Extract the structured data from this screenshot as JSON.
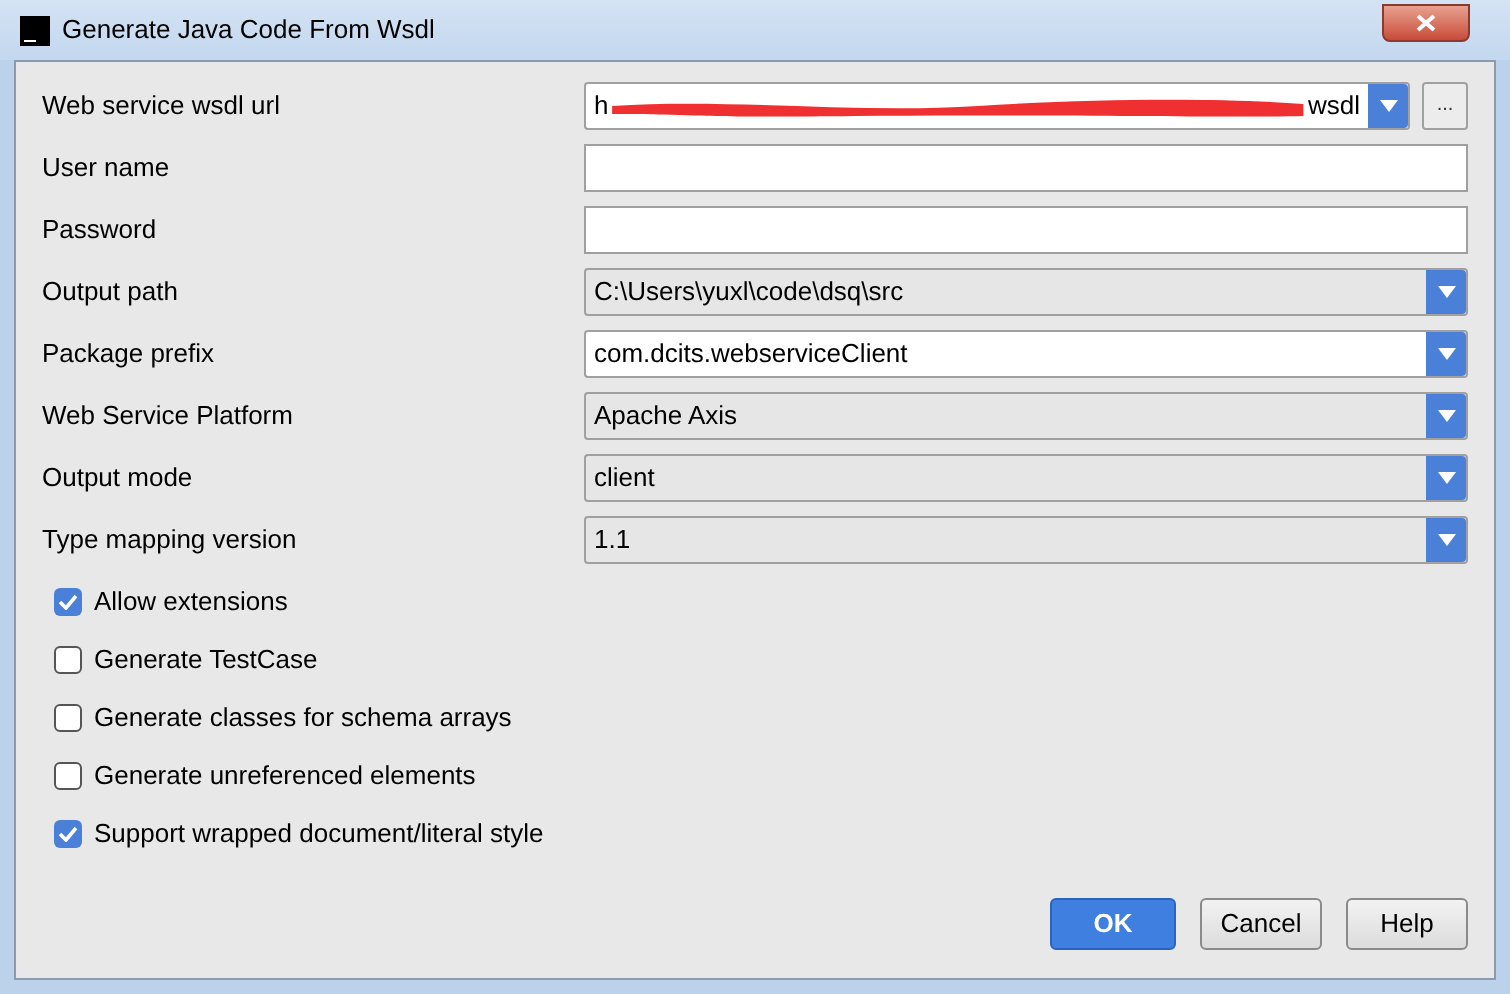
{
  "window": {
    "title": "Generate Java Code From Wsdl"
  },
  "fields": [
    {
      "label": "Web service wsdl url",
      "kind": "url",
      "value_start": "h",
      "value_end": "wsdl",
      "redacted": true
    },
    {
      "label": "User name",
      "kind": "text"
    },
    {
      "label": "Password",
      "kind": "text"
    },
    {
      "label": "Output path",
      "kind": "combo",
      "value": "C:\\Users\\yuxl\\code\\dsq\\src",
      "editable": false
    },
    {
      "label": "Package prefix",
      "kind": "combo",
      "value": "com.dcits.webserviceClient",
      "editable": true
    },
    {
      "label": "Web Service Platform",
      "kind": "combo",
      "value": "Apache Axis",
      "editable": false
    },
    {
      "label": "Output mode",
      "kind": "combo",
      "value": "client",
      "editable": false
    },
    {
      "label": "Type mapping version",
      "kind": "combo",
      "value": "1.1",
      "editable": false
    }
  ],
  "browse_button": "...",
  "options": [
    {
      "label": "Allow extensions",
      "checked": true
    },
    {
      "label": "Generate TestCase",
      "checked": false
    },
    {
      "label": "Generate classes for schema arrays",
      "checked": false
    },
    {
      "label": "Generate unreferenced elements",
      "checked": false
    },
    {
      "label": "Support wrapped document/literal style",
      "checked": true
    }
  ],
  "buttons": [
    {
      "label": "OK",
      "default": true
    },
    {
      "label": "Cancel",
      "default": false
    },
    {
      "label": "Help",
      "default": false
    }
  ]
}
